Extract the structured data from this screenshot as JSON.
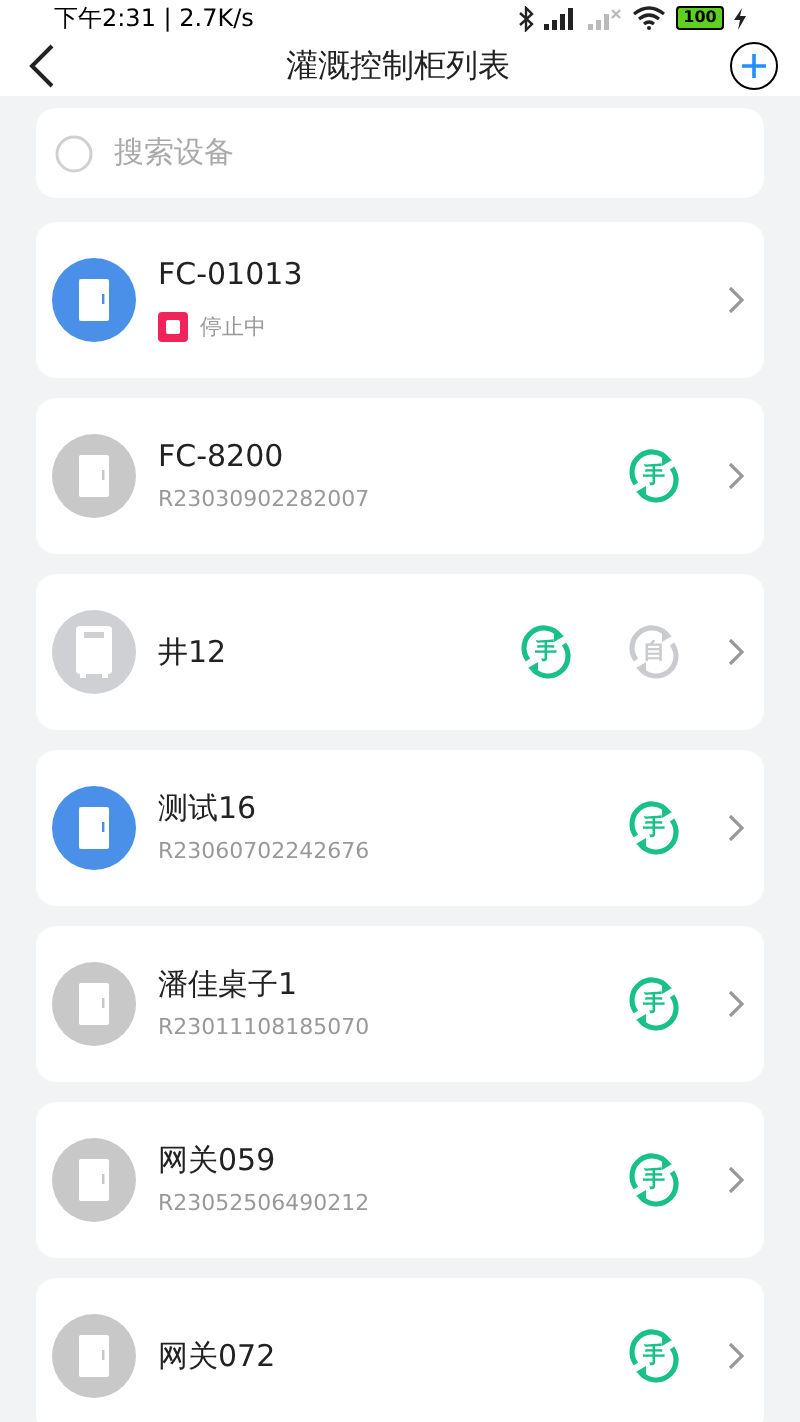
{
  "status_bar": {
    "time": "下午2:31 | 2.7K/s",
    "battery": "100"
  },
  "header": {
    "title": "灌溉控制柜列表"
  },
  "search": {
    "placeholder": "搜索设备"
  },
  "devices": [
    {
      "name": "FC-01013",
      "active": true,
      "kind": "cabinet",
      "status": "停止中"
    },
    {
      "name": "FC-8200",
      "active": false,
      "kind": "cabinet",
      "code": "R23030902282007",
      "modes": [
        {
          "label": "手",
          "on": true
        }
      ]
    },
    {
      "name": "井12",
      "active": false,
      "kind": "unit",
      "modes": [
        {
          "label": "手",
          "on": true
        },
        {
          "label": "自",
          "on": false
        }
      ]
    },
    {
      "name": "测试16",
      "active": true,
      "kind": "cabinet",
      "code": "R23060702242676",
      "modes": [
        {
          "label": "手",
          "on": true
        }
      ]
    },
    {
      "name": "潘佳桌子1",
      "active": false,
      "kind": "cabinet",
      "code": "R23011108185070",
      "modes": [
        {
          "label": "手",
          "on": true
        }
      ]
    },
    {
      "name": "网关059",
      "active": false,
      "kind": "cabinet",
      "code": "R23052506490212",
      "modes": [
        {
          "label": "手",
          "on": true
        }
      ]
    },
    {
      "name": "网关072",
      "active": false,
      "kind": "cabinet",
      "modes": [
        {
          "label": "手",
          "on": true
        }
      ]
    }
  ]
}
